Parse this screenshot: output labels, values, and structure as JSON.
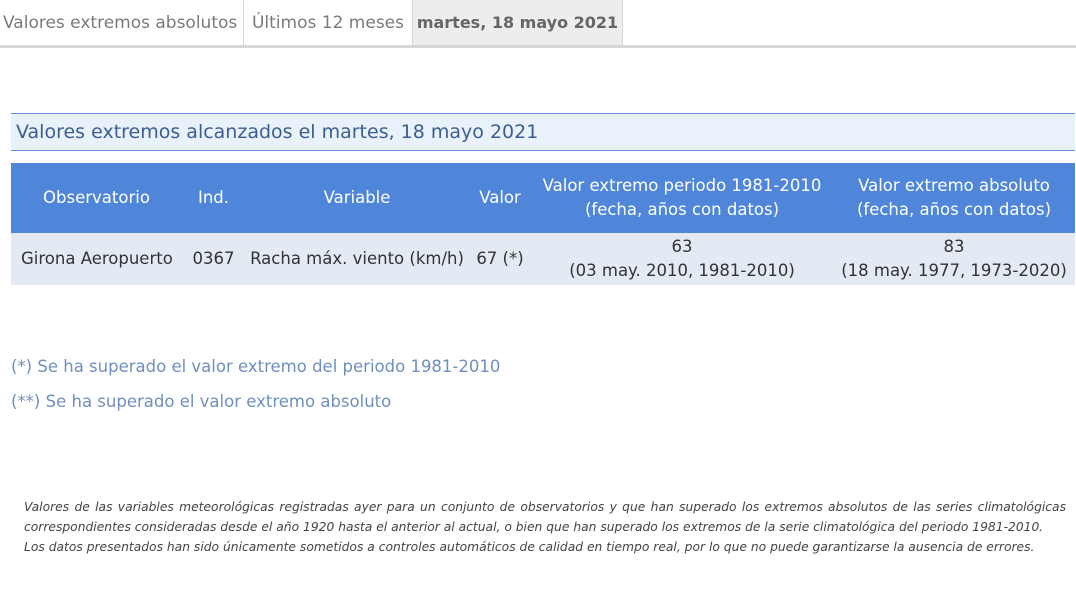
{
  "tabs": [
    {
      "label": "Valores extremos absolutos"
    },
    {
      "label": "Últimos 12 meses"
    },
    {
      "label": "martes, 18 mayo 2021"
    }
  ],
  "section": {
    "title": "Valores extremos alcanzados el martes, 18 mayo 2021"
  },
  "table": {
    "headers": {
      "observatorio": "Observatorio",
      "ind": "Ind.",
      "variable": "Variable",
      "valor": "Valor",
      "periodo_line1": "Valor extremo periodo 1981-2010",
      "periodo_line2": "(fecha, años con datos)",
      "absoluto_line1": "Valor extremo absoluto",
      "absoluto_line2": "(fecha, años con datos)"
    },
    "rows": [
      {
        "observatorio": "Girona Aeropuerto",
        "ind": "0367",
        "variable": "Racha máx. viento (km/h)",
        "valor": "67 (*)",
        "periodo_value": "63",
        "periodo_detail": "(03 may. 2010, 1981-2010)",
        "absoluto_value": "83",
        "absoluto_detail": "(18 may. 1977, 1973-2020)"
      }
    ]
  },
  "notes": {
    "note1": "(*) Se ha superado el valor extremo del periodo 1981-2010",
    "note2": "(**) Se ha superado el valor extremo absoluto"
  },
  "disclaimer": {
    "p1": "Valores de las variables meteorológicas registradas ayer para un conjunto de observatorios y que han superado los extremos absolutos de las series climatológicas correspondientes consideradas desde el año 1920 hasta el anterior al actual, o bien que han superado los extremos de la serie climatológica del periodo 1981-2010.",
    "p2": "Los datos presentados han sido únicamente sometidos a controles automáticos de calidad en tiempo real, por lo que no puede garantizarse la ausencia de errores."
  },
  "colors": {
    "header_bg": "#4f86d9",
    "row_bg": "#e3eaf4",
    "title_bg": "#e9f1fb",
    "title_text": "#3a5f8e",
    "note_text": "#6f8fbf"
  }
}
